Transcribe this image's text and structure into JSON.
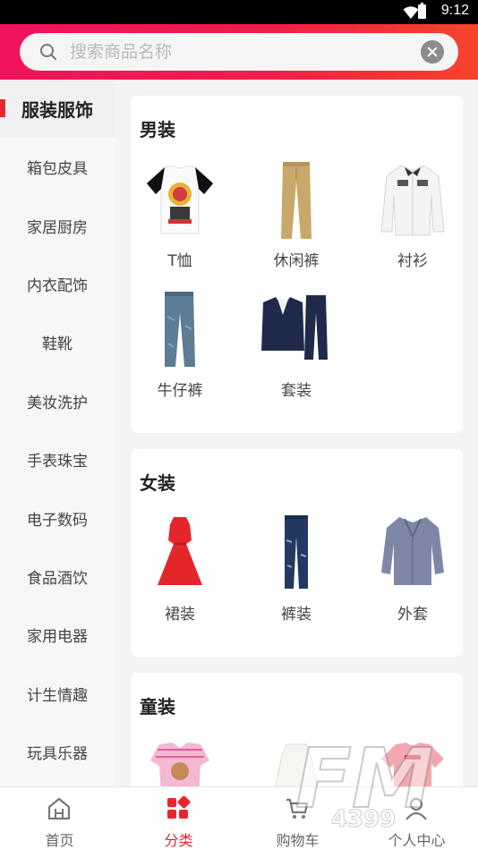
{
  "status": {
    "time": "9:12"
  },
  "search": {
    "placeholder": "搜索商品名称"
  },
  "sidebar": {
    "items": [
      {
        "label": "服装服饰",
        "active": true
      },
      {
        "label": "箱包皮具"
      },
      {
        "label": "家居厨房"
      },
      {
        "label": "内衣配饰"
      },
      {
        "label": "鞋靴"
      },
      {
        "label": "美妆洗护"
      },
      {
        "label": "手表珠宝"
      },
      {
        "label": "电子数码"
      },
      {
        "label": "食品酒饮"
      },
      {
        "label": "家用电器"
      },
      {
        "label": "计生情趣"
      },
      {
        "label": "玩具乐器"
      }
    ]
  },
  "sections": [
    {
      "title": "男装",
      "items": [
        {
          "label": "T恤"
        },
        {
          "label": "休闲裤"
        },
        {
          "label": "衬衫"
        },
        {
          "label": "牛仔裤"
        },
        {
          "label": "套装"
        }
      ]
    },
    {
      "title": "女装",
      "items": [
        {
          "label": "裙装"
        },
        {
          "label": "裤装"
        },
        {
          "label": "外套"
        }
      ]
    },
    {
      "title": "童装",
      "items": [
        {
          "label": ""
        },
        {
          "label": ""
        },
        {
          "label": ""
        }
      ]
    }
  ],
  "tabbar": {
    "items": [
      {
        "label": "首页"
      },
      {
        "label": "分类",
        "active": true
      },
      {
        "label": "购物车"
      },
      {
        "label": "个人中心"
      }
    ]
  },
  "watermark": {
    "text": "4399",
    "logo": "FM"
  },
  "colors": {
    "accent": "#e8252f",
    "header_start": "#f0145c",
    "header_end": "#f6442b"
  }
}
